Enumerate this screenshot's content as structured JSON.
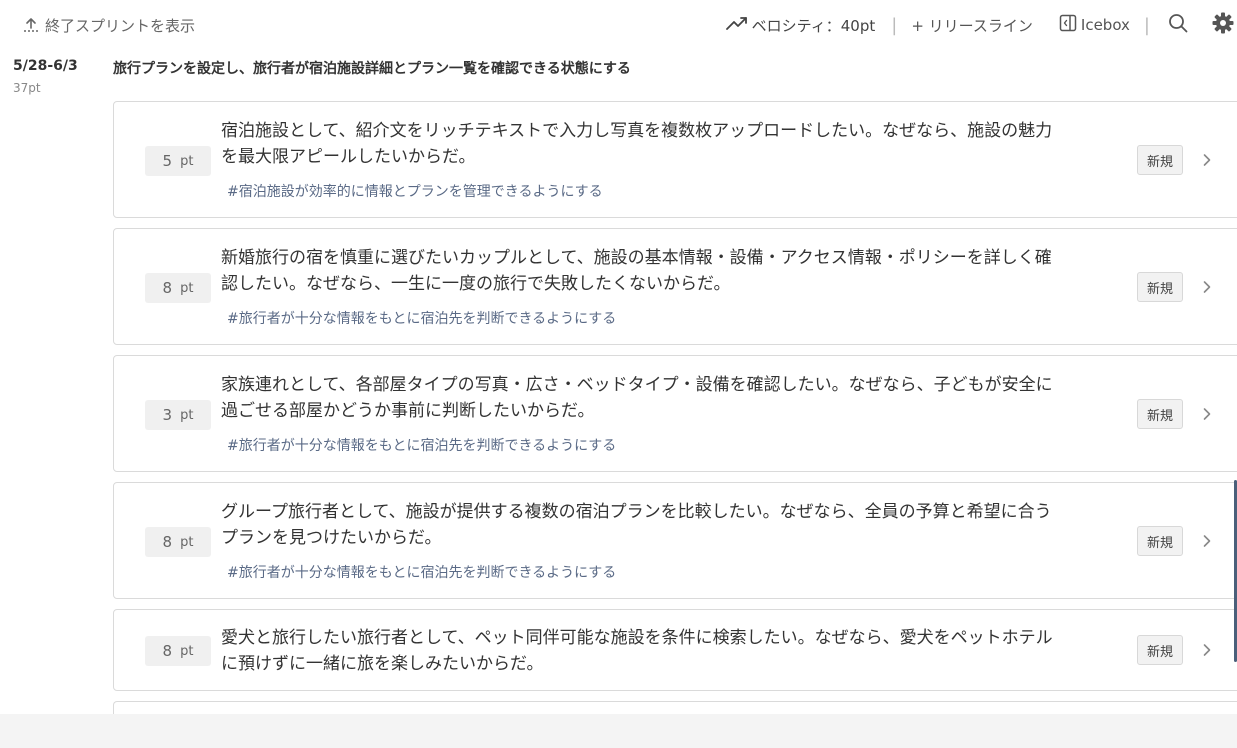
{
  "topbar": {
    "show_ended_sprints": "終了スプリントを表示",
    "velocity": "ベロシティ：40pt",
    "release_line": "+ リリースライン",
    "icebox": "Icebox",
    "icons": [
      "upload-arrow-icon",
      "trend-up-icon",
      "icebox-panel-icon",
      "search-icon",
      "gear-icon"
    ]
  },
  "sprint": {
    "dates": "5/28-6/3",
    "points": "37pt",
    "goal": "旅行プランを設定し、旅行者が宿泊施設詳細とプラン一覧を確認できる状態にする"
  },
  "stories": [
    {
      "points": "5",
      "unit": "pt",
      "line1": "宿泊施設として、紹介文をリッチテキストで入力し写真を複数枚アップロードしたい。なぜなら、施設の魅力",
      "line2": "を最大限アピールしたいからだ。",
      "epic": "#宿泊施設が効率的に情報とプランを管理できるようにする",
      "status": "新規"
    },
    {
      "points": "8",
      "unit": "pt",
      "line1": "新婚旅行の宿を慎重に選びたいカップルとして、施設の基本情報・設備・アクセス情報・ポリシーを詳しく確",
      "line2": "認したい。なぜなら、一生に一度の旅行で失敗したくないからだ。",
      "epic": "#旅行者が十分な情報をもとに宿泊先を判断できるようにする",
      "status": "新規"
    },
    {
      "points": "3",
      "unit": "pt",
      "line1": "家族連れとして、各部屋タイプの写真・広さ・ベッドタイプ・設備を確認したい。なぜなら、子どもが安全に",
      "line2": "過ごせる部屋かどうか事前に判断したいからだ。",
      "epic": "#旅行者が十分な情報をもとに宿泊先を判断できるようにする",
      "status": "新規"
    },
    {
      "points": "8",
      "unit": "pt",
      "line1": "グループ旅行者として、施設が提供する複数の宿泊プランを比較したい。なぜなら、全員の予算と希望に合う",
      "line2": "プランを見つけたいからだ。",
      "epic": "#旅行者が十分な情報をもとに宿泊先を判断できるようにする",
      "status": "新規"
    },
    {
      "points": "8",
      "unit": "pt",
      "line1": "愛犬と旅行したい旅行者として、ペット同伴可能な施設を条件に検索したい。なぜなら、愛犬をペットホテル",
      "line2": "に預けずに一緒に旅を楽しみたいからだ。",
      "epic": "",
      "status": "新規"
    }
  ]
}
